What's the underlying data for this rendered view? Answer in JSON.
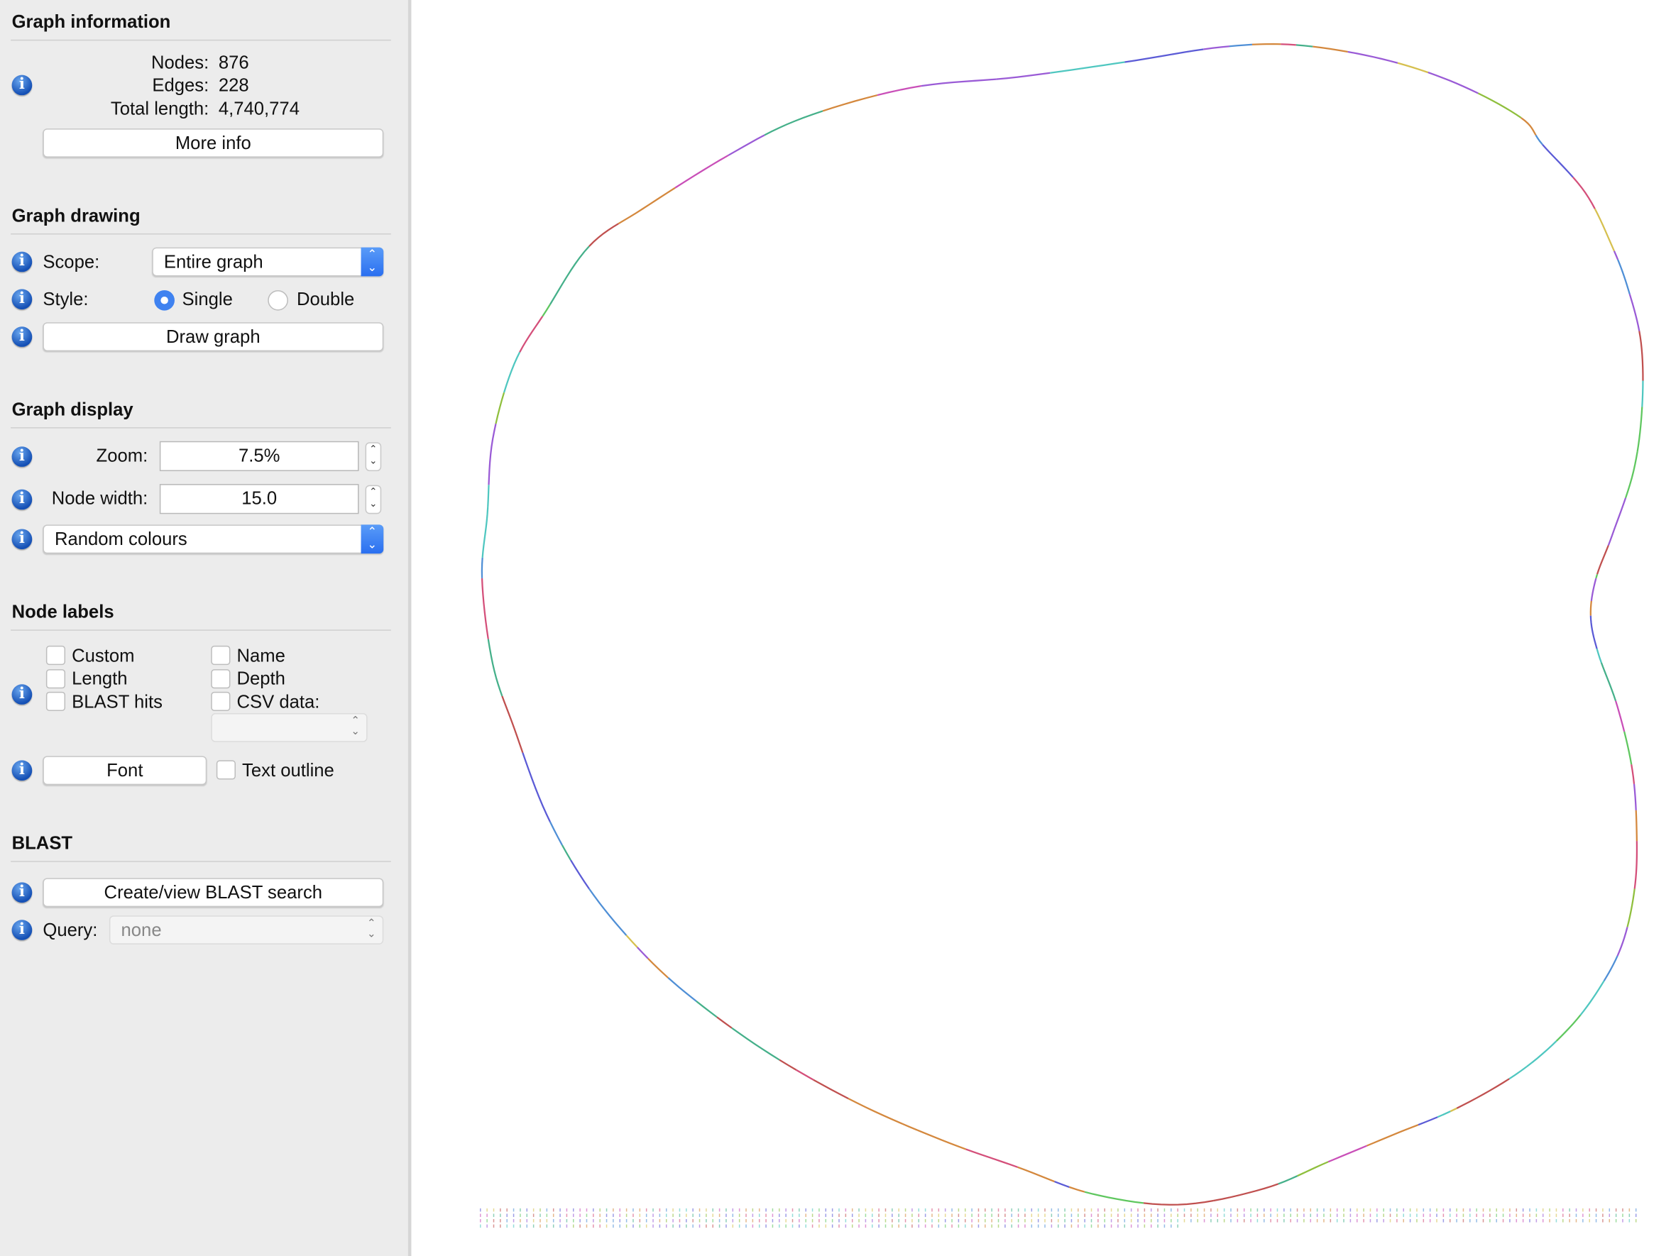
{
  "graph_information": {
    "heading": "Graph information",
    "nodes_label": "Nodes:",
    "nodes_value": "876",
    "edges_label": "Edges:",
    "edges_value": "228",
    "total_length_label": "Total length:",
    "total_length_value": "4,740,774",
    "more_info_button": "More info"
  },
  "graph_drawing": {
    "heading": "Graph drawing",
    "scope_label": "Scope:",
    "scope_value": "Entire graph",
    "style_label": "Style:",
    "style_options": [
      {
        "label": "Single",
        "selected": true
      },
      {
        "label": "Double",
        "selected": false
      }
    ],
    "draw_button": "Draw graph"
  },
  "graph_display": {
    "heading": "Graph display",
    "zoom_label": "Zoom:",
    "zoom_value": "7.5%",
    "node_width_label": "Node width:",
    "node_width_value": "15.0",
    "colour_scheme": "Random colours"
  },
  "node_labels": {
    "heading": "Node labels",
    "checkboxes": [
      {
        "label": "Custom",
        "checked": false
      },
      {
        "label": "Length",
        "checked": false
      },
      {
        "label": "BLAST hits",
        "checked": false
      },
      {
        "label": "Name",
        "checked": false
      },
      {
        "label": "Depth",
        "checked": false
      },
      {
        "label": "CSV data:",
        "checked": false
      }
    ],
    "csv_value": "",
    "font_button": "Font",
    "text_outline_label": "Text outline",
    "text_outline_checked": false
  },
  "blast": {
    "heading": "BLAST",
    "create_button": "Create/view BLAST search",
    "query_label": "Query:",
    "query_value": "none"
  },
  "graph_view": {
    "segment_colours": [
      "#5b5bd6",
      "#c94fb8",
      "#d4883d",
      "#5fc75f",
      "#4fc7c0",
      "#d44f7a",
      "#9a5bd6",
      "#8fbf3d",
      "#4f8fd6",
      "#d6c04f",
      "#c0504f",
      "#45b08a"
    ]
  },
  "icons": {
    "info": "info-icon",
    "updown": "chevron-updown-icon"
  },
  "accent_colour": "#3f82f0"
}
